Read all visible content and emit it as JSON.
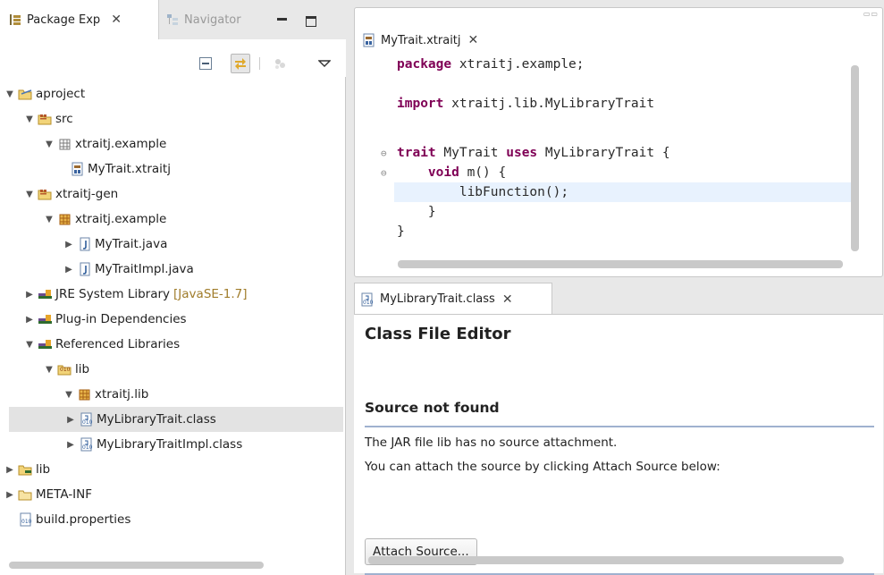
{
  "left_view": {
    "tabs": [
      {
        "label": "Package Exp"
      },
      {
        "label": "Navigator"
      }
    ],
    "tree": [
      {
        "label": "aproject",
        "icon": "project-icon"
      },
      {
        "label": "src",
        "icon": "source-folder-icon"
      },
      {
        "label": "xtraitj.example",
        "icon": "empty-package-icon"
      },
      {
        "label": "MyTrait.xtraitj",
        "icon": "xtraitj-file-icon"
      },
      {
        "label": "xtraitj-gen",
        "icon": "source-folder-icon"
      },
      {
        "label": "xtraitj.example",
        "icon": "package-icon"
      },
      {
        "label": "MyTrait.java",
        "icon": "java-file-icon"
      },
      {
        "label": "MyTraitImpl.java",
        "icon": "java-file-icon"
      },
      {
        "label": "JRE System Library",
        "decoration": "[JavaSE-1.7]",
        "icon": "library-icon"
      },
      {
        "label": "Plug-in Dependencies",
        "icon": "library-icon"
      },
      {
        "label": "Referenced Libraries",
        "icon": "library-icon"
      },
      {
        "label": "lib",
        "icon": "jar-folder-icon"
      },
      {
        "label": "xtraitj.lib",
        "icon": "package-icon"
      },
      {
        "label": "MyLibraryTrait.class",
        "icon": "class-file-icon"
      },
      {
        "label": "MyLibraryTraitImpl.class",
        "icon": "class-file-icon"
      },
      {
        "label": "lib",
        "icon": "folder-icon"
      },
      {
        "label": "META-INF",
        "icon": "folder-icon"
      },
      {
        "label": "build.properties",
        "icon": "properties-file-icon"
      }
    ]
  },
  "editor": {
    "tab_label": "MyTrait.xtraitj",
    "code": {
      "l1_kw": "package",
      "l1_rest": " xtraitj.example;",
      "l2_kw": "import",
      "l2_rest": " xtraitj.lib.MyLibraryTrait",
      "l3_kw1": "trait",
      "l3_mid": " MyTrait ",
      "l3_kw2": "uses",
      "l3_rest": " MyLibraryTrait {",
      "l4_indent": "    ",
      "l4_kw": "void",
      "l4_rest": " m() {",
      "l5": "        libFunction();",
      "l6": "    }",
      "l7": "}"
    }
  },
  "class_file_editor": {
    "tab_label": "MyLibraryTrait.class",
    "title": "Class File Editor",
    "section_title": "Source not found",
    "message1": "The JAR file lib has no source attachment.",
    "message2": "You can attach the source by clicking Attach Source below:",
    "attach_mnemonic": "A",
    "attach_rest": "ttach Source..."
  },
  "colors": {
    "keyword": "#7f0055",
    "current_line": "#e8f2fe",
    "selection": "#e3e3e3",
    "section_rule": "#9fb1cf",
    "library_decoration": "#a07c2a"
  }
}
